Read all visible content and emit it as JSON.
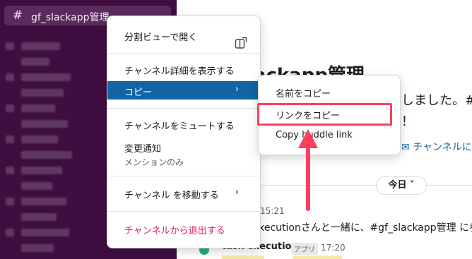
{
  "sidebar": {
    "channel_hash": "#",
    "channel_name": "gf_slackapp管理"
  },
  "main": {
    "title": "lackapp管理",
    "subtitle": "成しました。#",
    "subtitle2": "！",
    "details_link": "チャンネルに",
    "date_divider": "今日",
    "msg1_time": "15:21",
    "msg1_text": "xecutionさんと一緒に、#gf_slackapp管理 に参加し",
    "msg2_sender": "task execution",
    "msg2_badge": "アプリ",
    "msg2_time": "17:20"
  },
  "menu": {
    "open_split": "分割ビューで開く",
    "show_details": "チャンネル詳細を表示する",
    "copy": "コピー",
    "mute": "チャンネルをミュートする",
    "notify": "変更通知",
    "notify_sub": "メンションのみ",
    "move": "チャンネル を移動する",
    "leave": "チャンネルから退出する"
  },
  "submenu": {
    "copy_name": "名前をコピー",
    "copy_link": "リンクをコピー",
    "copy_huddle": "Copy huddle link"
  },
  "colors": {
    "accent": "#1264a3",
    "sidebar": "#3f0e40",
    "danger": "#e01e5a",
    "annotation": "#ff3e5f"
  }
}
